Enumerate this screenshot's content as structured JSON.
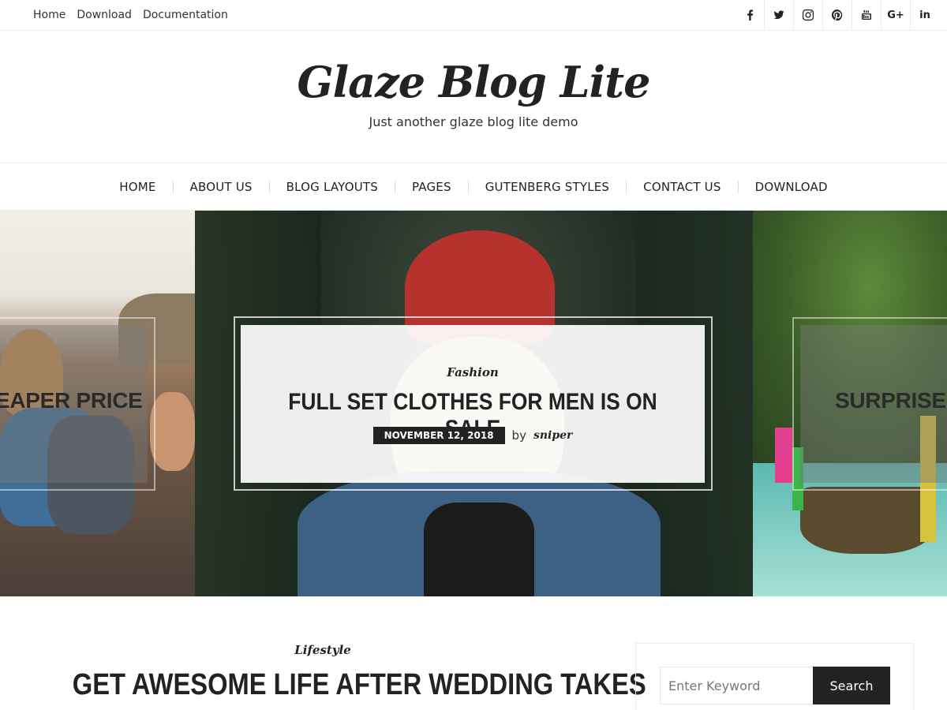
{
  "top_nav": {
    "items": [
      "Home",
      "Download",
      "Documentation"
    ]
  },
  "social": {
    "icons": [
      "facebook-icon",
      "twitter-icon",
      "instagram-icon",
      "pinterest-icon",
      "youtube-icon",
      "google-plus-icon",
      "linkedin-icon"
    ],
    "google_plus_label": "G+",
    "linkedin_label": "in"
  },
  "branding": {
    "site_title": "Glaze Blog Lite",
    "tagline": "Just another glaze blog lite demo"
  },
  "main_nav": {
    "items": [
      "HOME",
      "ABOUT US",
      "BLOG LAYOUTS",
      "PAGES",
      "GUTENBERG STYLES",
      "CONTACT US",
      "DOWNLOAD"
    ]
  },
  "slider": {
    "left": {
      "title": "EAPER PRICE"
    },
    "center": {
      "category": "Fashion",
      "title": "FULL SET CLOTHES FOR MEN IS ON SALE",
      "date": "NOVEMBER 12, 2018",
      "by": "by",
      "author": "sniper"
    },
    "right": {
      "title": "SURPRISE FO"
    }
  },
  "post": {
    "category": "Lifestyle",
    "title": "GET AWESOME LIFE AFTER WEDDING TAKES"
  },
  "search_widget": {
    "placeholder": "Enter Keyword",
    "button_label": "Search"
  },
  "colors": {
    "text": "#222222",
    "border": "#ececec",
    "button_bg": "#222222"
  }
}
